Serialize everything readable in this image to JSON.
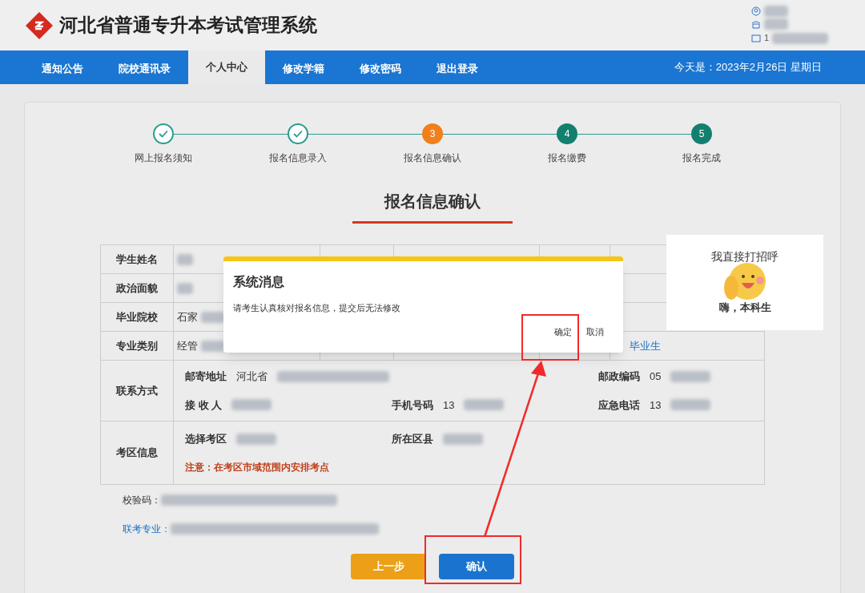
{
  "header": {
    "title": "河北省普通专升本考试管理系统",
    "user_info": [
      {
        "kind": "user"
      },
      {
        "kind": "phone"
      },
      {
        "kind": "id",
        "text": "1"
      }
    ]
  },
  "nav": {
    "items": [
      {
        "label": "通知公告",
        "selected": false
      },
      {
        "label": "院校通讯录",
        "selected": false
      },
      {
        "label": "个人中心",
        "selected": true
      },
      {
        "label": "修改学籍",
        "selected": false
      },
      {
        "label": "修改密码",
        "selected": false
      },
      {
        "label": "退出登录",
        "selected": false
      }
    ],
    "date": "今天是：2023年2月26日 星期日"
  },
  "steps": [
    {
      "label": "网上报名须知",
      "kind": "done"
    },
    {
      "label": "报名信息录入",
      "kind": "done"
    },
    {
      "label": "报名信息确认",
      "kind": "current",
      "number": "3"
    },
    {
      "label": "报名缴费",
      "kind": "todo",
      "number": "4"
    },
    {
      "label": "报名完成",
      "kind": "todo",
      "number": "5"
    }
  ],
  "page_title": "报名信息确认",
  "table": {
    "rows": [
      {
        "label": "学生姓名"
      },
      {
        "label": "政治面貌"
      },
      {
        "label": "毕业院校",
        "value": "石家"
      },
      {
        "label": "专业类别",
        "value": "经管",
        "extra": "毕业生"
      }
    ],
    "contact": {
      "label": "联系方式",
      "fields": [
        {
          "label": "邮寄地址",
          "value": "河北省"
        },
        {
          "label": "邮政编码",
          "value": "05"
        },
        {
          "label": "接 收 人"
        },
        {
          "label": "手机号码",
          "value": "13"
        },
        {
          "label": "应急电话",
          "value": "13"
        }
      ]
    },
    "exam": {
      "label": "考区信息",
      "fields": [
        {
          "label": "选择考区"
        },
        {
          "label": "所在区县"
        }
      ],
      "note": "注意：在考区市域范围内安排考点"
    }
  },
  "check_code": {
    "label": "校验码："
  },
  "major": {
    "label": "联考专业："
  },
  "buttons": [
    {
      "label": "上一步",
      "kind": "secondary"
    },
    {
      "label": "确认",
      "kind": "primary"
    }
  ],
  "dialog": {
    "title": "系统消息",
    "message": "请考生认真核对报名信息，提交后无法修改",
    "buttons": [
      "确定",
      "取消"
    ]
  },
  "sticker": {
    "top": "我直接打招呼",
    "bottom": "嗨，本科生"
  }
}
